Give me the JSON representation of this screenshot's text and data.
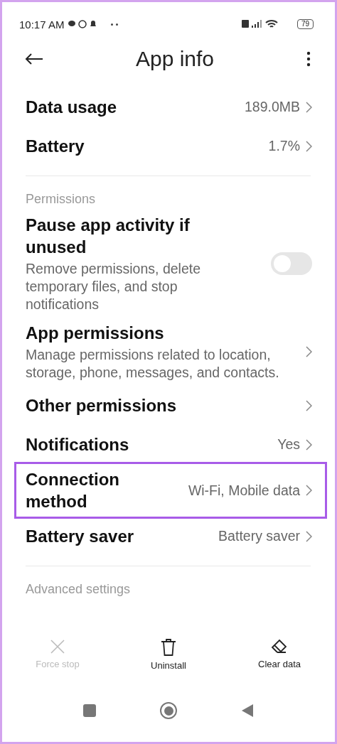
{
  "status_bar": {
    "time": "10:17 AM",
    "battery": "79"
  },
  "header": {
    "title": "App info"
  },
  "items": [
    {
      "kind": "link",
      "title": "Data usage",
      "value": "189.0MB",
      "highlighted": false
    },
    {
      "kind": "link",
      "title": "Battery",
      "value": "1.7%",
      "highlighted": false
    },
    {
      "kind": "section",
      "title": "Permissions"
    },
    {
      "kind": "toggle",
      "title": "Pause app activity if unused",
      "description": "Remove permissions, delete temporary files, and stop notifications",
      "on": false
    },
    {
      "kind": "link",
      "title": "App permissions",
      "description": "Manage permissions related to location, storage, phone, messages, and contacts.",
      "highlighted": false
    },
    {
      "kind": "link",
      "title": "Other permissions",
      "highlighted": false
    },
    {
      "kind": "link",
      "title": "Notifications",
      "value": "Yes",
      "highlighted": false
    },
    {
      "kind": "link",
      "title": "Connection method",
      "value": "Wi-Fi, Mobile data",
      "highlighted": true
    },
    {
      "kind": "link",
      "title": "Battery saver",
      "value": "Battery saver",
      "highlighted": false
    },
    {
      "kind": "section",
      "title": "Advanced settings"
    }
  ],
  "actions": [
    {
      "kind": "close",
      "label": "Force stop",
      "disabled": true
    },
    {
      "kind": "trash",
      "label": "Uninstall",
      "disabled": false
    },
    {
      "kind": "eraser",
      "label": "Clear data",
      "disabled": false
    }
  ]
}
